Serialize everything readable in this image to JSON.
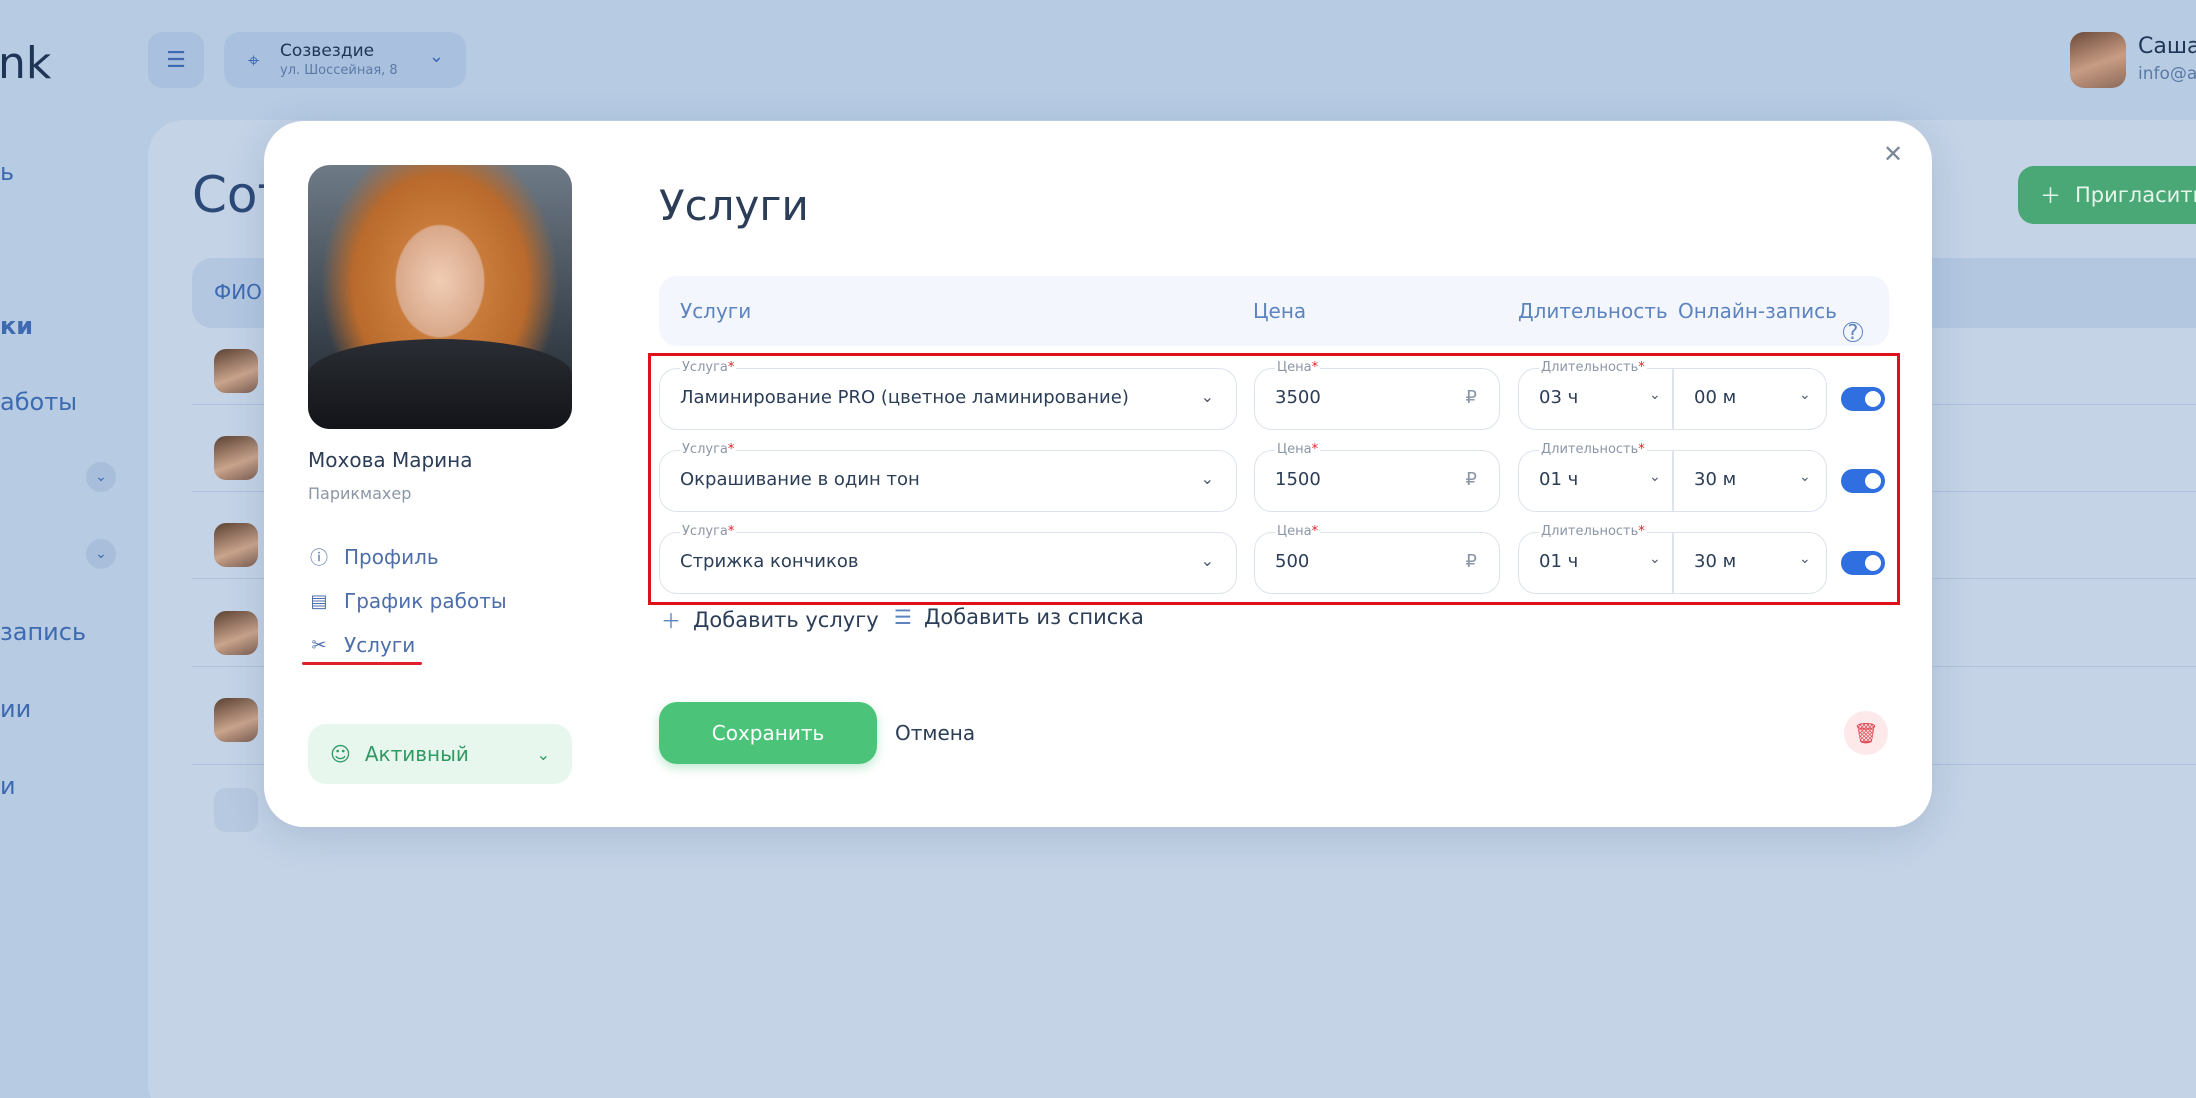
{
  "app": {
    "logo_text": "nk",
    "location": {
      "name": "Созвездие",
      "address": "ул. Шоссейная, 8"
    },
    "user": {
      "name": "Саша",
      "email": "info@al"
    },
    "nav_items": [
      "ь",
      "ки",
      "аботы",
      "запись",
      "ии",
      "и"
    ],
    "page_title": "Сот",
    "table_head_fio": "ФИО",
    "invite_label": "Пригласить"
  },
  "modal": {
    "staff": {
      "name": "Мохова Марина",
      "role": "Парикмахер"
    },
    "nav": [
      {
        "label": "Профиль",
        "icon": "info-icon"
      },
      {
        "label": "График работы",
        "icon": "calendar-icon"
      },
      {
        "label": "Услуги",
        "icon": "scissors-icon",
        "active": true
      }
    ],
    "status_label": "Активный",
    "title": "Услуги",
    "columns": {
      "service": "Услуги",
      "price": "Цена",
      "duration": "Длительность",
      "online": "Онлайн-запись"
    },
    "field_labels": {
      "service": "Услуга",
      "price": "Цена",
      "duration": "Длительность",
      "required_mark": "*"
    },
    "currency_symbol": "₽",
    "services": [
      {
        "name": "Ламинирование PRO (цветное ламинирование)",
        "price": "3500",
        "hours": "03 ч",
        "minutes": "00 м",
        "online": true
      },
      {
        "name": "Окрашивание в один тон",
        "price": "1500",
        "hours": "01 ч",
        "minutes": "30 м",
        "online": true
      },
      {
        "name": "Стрижка кончиков",
        "price": "500",
        "hours": "01 ч",
        "minutes": "30 м",
        "online": true
      }
    ],
    "add_service_label": "Добавить услугу",
    "add_from_list_label": "Добавить из списка",
    "save_label": "Сохранить",
    "cancel_label": "Отмена"
  },
  "colors": {
    "accent": "#2f6fe0",
    "save": "#4bc47a",
    "highlight": "#e0101a"
  }
}
